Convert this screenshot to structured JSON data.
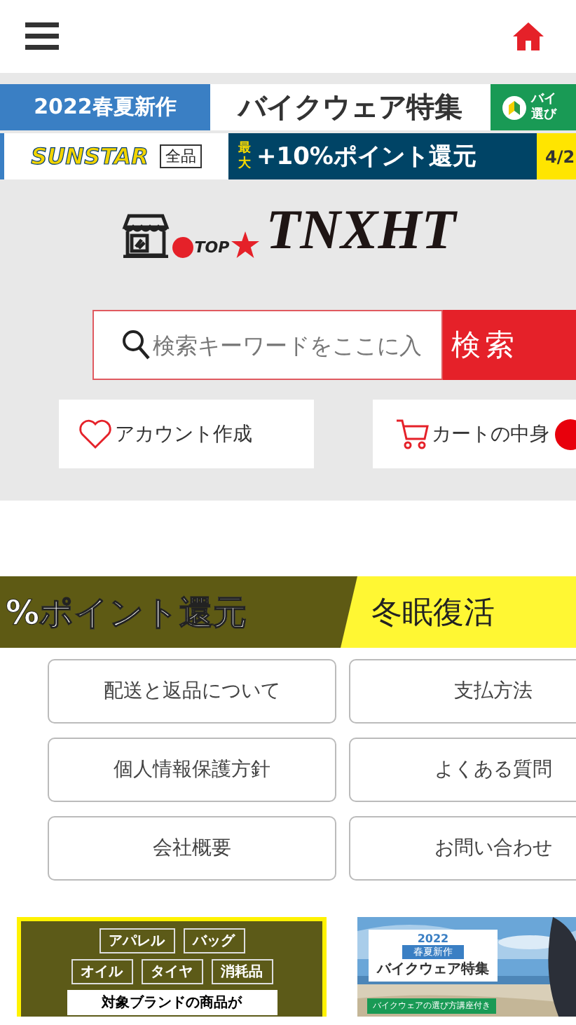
{
  "top_banners": [
    {
      "kind": "apparel",
      "badge": "2022春夏新作",
      "title": "バイクウェア特集",
      "side": [
        "バイ",
        "選び"
      ]
    },
    {
      "kind": "points",
      "brand": "SUNSTAR",
      "scope": "全品",
      "max": "最大",
      "offer": "+10%ポイント還元",
      "date": "4/2"
    }
  ],
  "logo": {
    "top": "TOP",
    "name": "TNXHT"
  },
  "search": {
    "placeholder": "検索キーワードをここに入",
    "button": "検索"
  },
  "account_buttons": [
    {
      "kind": "heart",
      "label": "アカウント作成"
    },
    {
      "kind": "cart",
      "label": "カートの中身"
    }
  ],
  "wide_banner": {
    "offer": "%ポイント還元",
    "tag": "冬眠復活"
  },
  "links": [
    "配送と返品について",
    "支払方法",
    "個人情報保護方針",
    "よくある質問",
    "会社概要",
    "お問い合わせ"
  ],
  "cards": [
    {
      "kind": "brands",
      "tags": [
        "アパレル",
        "バッグ",
        "オイル",
        "タイヤ",
        "消耗品"
      ],
      "note": "対象ブランドの商品が"
    },
    {
      "kind": "wear",
      "year": "2022",
      "badge": "春夏新作",
      "title": "バイクウェア特集",
      "ribbon": "バイクウェアの選び方講座付き"
    }
  ]
}
